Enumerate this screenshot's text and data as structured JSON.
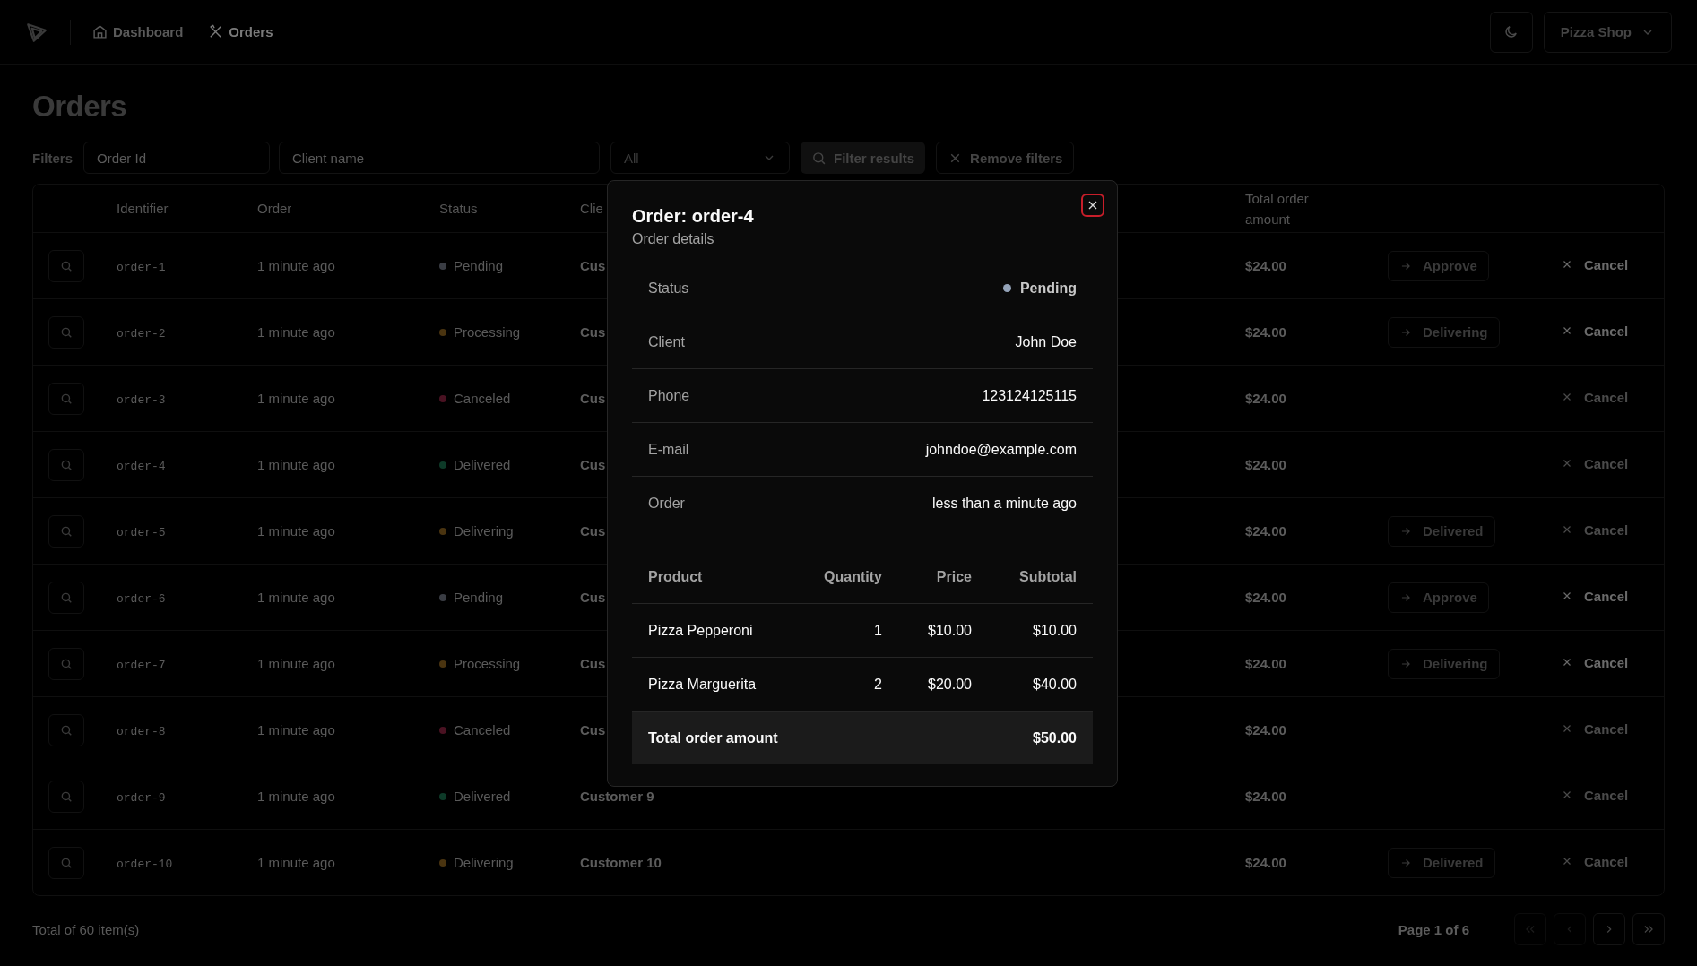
{
  "nav": {
    "items": [
      {
        "label": "Dashboard",
        "selected": false
      },
      {
        "label": "Orders",
        "selected": true
      }
    ],
    "store": "Pizza Shop"
  },
  "page": {
    "title": "Orders"
  },
  "filters": {
    "label": "Filters",
    "order_id": {
      "placeholder": "Order Id"
    },
    "client_name": {
      "placeholder": "Client name"
    },
    "status_select": "All",
    "apply": "Filter results",
    "remove": "Remove filters"
  },
  "table": {
    "columns": [
      "Identifier",
      "Order",
      "Status",
      "Clie",
      "Total order amount"
    ],
    "rows": [
      {
        "id": "order-1",
        "time": "1 minute ago",
        "status": "Pending",
        "color": "#3a3d44",
        "client": "Cus",
        "total": "$24.00",
        "action": "Approve",
        "cancel": "Cancel",
        "cancel_disabled": false
      },
      {
        "id": "order-2",
        "time": "1 minute ago",
        "status": "Processing",
        "color": "#4a3410",
        "client": "Cus",
        "total": "$24.00",
        "action": "Delivering",
        "cancel": "Cancel",
        "cancel_disabled": false
      },
      {
        "id": "order-3",
        "time": "1 minute ago",
        "status": "Canceled",
        "color": "#4a1222",
        "client": "Cus",
        "total": "$24.00",
        "cancel": "Cancel",
        "cancel_disabled": true
      },
      {
        "id": "order-4",
        "time": "1 minute ago",
        "status": "Delivered",
        "color": "#0d3a28",
        "client": "Cus",
        "total": "$24.00",
        "cancel": "Cancel",
        "cancel_disabled": true
      },
      {
        "id": "order-5",
        "time": "1 minute ago",
        "status": "Delivering",
        "color": "#4a3410",
        "client": "Cus",
        "total": "$24.00",
        "action": "Delivered",
        "cancel": "Cancel",
        "cancel_disabled": true
      },
      {
        "id": "order-6",
        "time": "1 minute ago",
        "status": "Pending",
        "color": "#3a3d44",
        "client": "Cus",
        "total": "$24.00",
        "action": "Approve",
        "cancel": "Cancel",
        "cancel_disabled": false
      },
      {
        "id": "order-7",
        "time": "1 minute ago",
        "status": "Processing",
        "color": "#4a3410",
        "client": "Cus",
        "total": "$24.00",
        "action": "Delivering",
        "cancel": "Cancel",
        "cancel_disabled": false
      },
      {
        "id": "order-8",
        "time": "1 minute ago",
        "status": "Canceled",
        "color": "#4a1222",
        "client": "Cus",
        "total": "$24.00",
        "cancel": "Cancel",
        "cancel_disabled": true
      },
      {
        "id": "order-9",
        "time": "1 minute ago",
        "status": "Delivered",
        "color": "#0d3a28",
        "client": "Customer 9",
        "total": "$24.00",
        "cancel": "Cancel",
        "cancel_disabled": true
      },
      {
        "id": "order-10",
        "time": "1 minute ago",
        "status": "Delivering",
        "color": "#4a3410",
        "client": "Customer 10",
        "total": "$24.00",
        "action": "Delivered",
        "cancel": "Cancel",
        "cancel_disabled": true
      }
    ]
  },
  "footer": {
    "total": "Total of 60 item(s)",
    "page": "Page 1 of 6",
    "first_disabled": true,
    "prev_disabled": true,
    "next_disabled": false,
    "last_disabled": false
  },
  "dialog": {
    "title": "Order: order-4",
    "subtitle": "Order details",
    "details": [
      {
        "label": "Status",
        "value": "Pending",
        "color": "#94a3b8"
      },
      {
        "label": "Client",
        "value": "John Doe"
      },
      {
        "label": "Phone",
        "value": "123124125115"
      },
      {
        "label": "E-mail",
        "value": "johndoe@example.com"
      },
      {
        "label": "Order",
        "value": "less than a minute ago"
      }
    ],
    "products": {
      "columns": [
        "Product",
        "Quantity",
        "Price",
        "Subtotal"
      ],
      "rows": [
        [
          "Pizza Pepperoni",
          "1",
          "$10.00",
          "$10.00"
        ],
        [
          "Pizza Marguerita",
          "2",
          "$20.00",
          "$40.00"
        ]
      ],
      "total_label": "Total order amount",
      "total": "$50.00"
    }
  }
}
